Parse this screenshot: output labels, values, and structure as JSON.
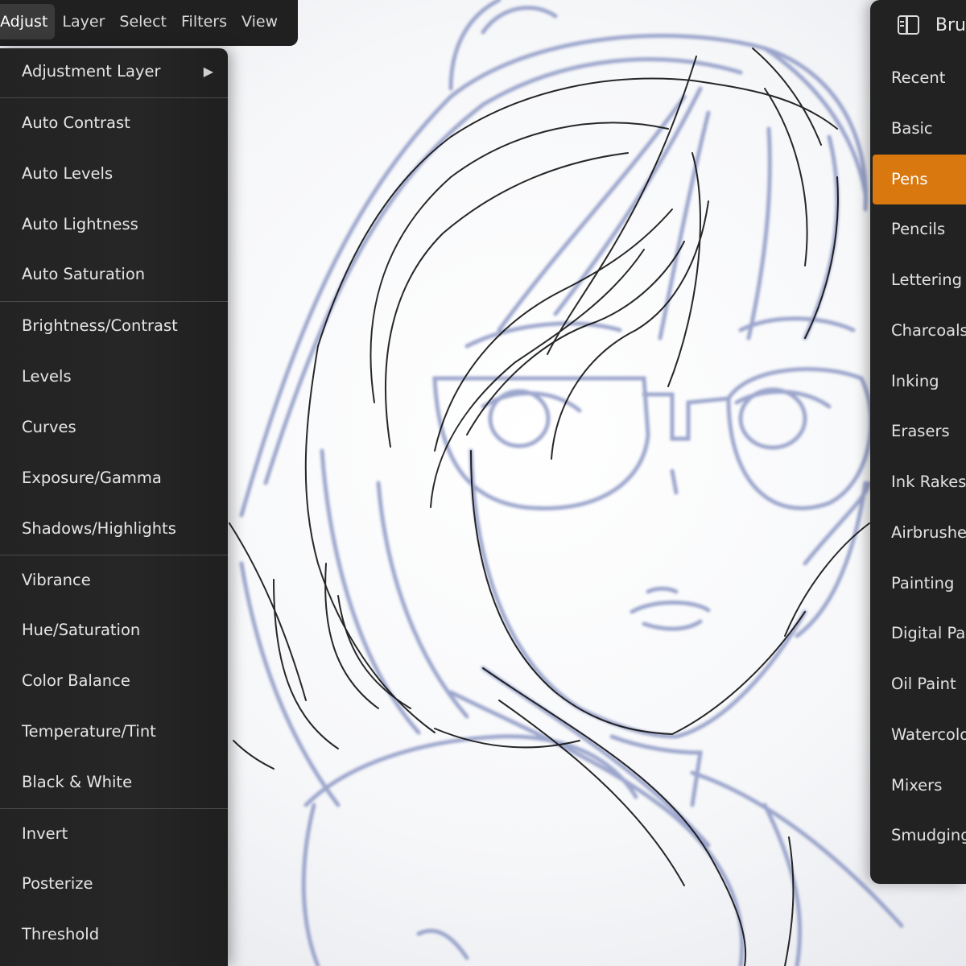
{
  "menubar": {
    "items": [
      {
        "label": "Adjust",
        "active": true
      },
      {
        "label": "Layer"
      },
      {
        "label": "Select"
      },
      {
        "label": "Filters"
      },
      {
        "label": "View"
      }
    ]
  },
  "adjust_menu": {
    "submenu_arrow": "▶",
    "groups": [
      [
        "Adjustment Layer"
      ],
      [
        "Auto Contrast",
        "Auto Levels",
        "Auto Lightness",
        "Auto Saturation"
      ],
      [
        "Brightness/Contrast",
        "Levels",
        "Curves",
        "Exposure/Gamma",
        "Shadows/Highlights"
      ],
      [
        "Vibrance",
        "Hue/Saturation",
        "Color Balance",
        "Temperature/Tint",
        "Black & White"
      ],
      [
        "Invert",
        "Posterize",
        "Threshold"
      ]
    ]
  },
  "brush_panel": {
    "icon": "panel-toggle-icon",
    "title": "Bru",
    "categories": [
      "Recent",
      "Basic",
      "Pens",
      "Pencils",
      "Lettering",
      "Charcoals",
      "Inking",
      "Erasers",
      "Ink Rakes",
      "Airbrushes",
      "Painting",
      "Digital Pai",
      "Oil Paint",
      "Watercolo",
      "Mixers",
      "Smudging"
    ],
    "active_category": "Pens"
  },
  "colors": {
    "accent": "#d8780f",
    "panel_bg": "#222222",
    "sketch_line": "#8c97c4",
    "ink_line": "#111111"
  }
}
